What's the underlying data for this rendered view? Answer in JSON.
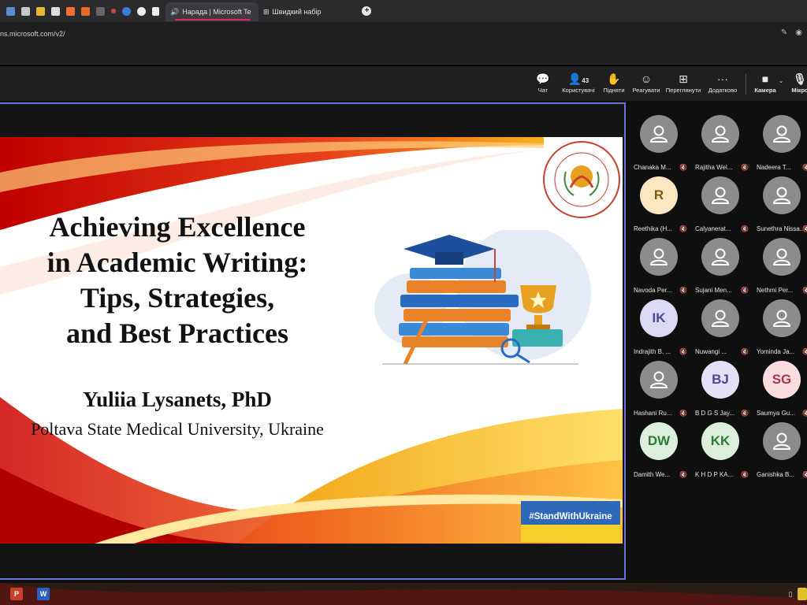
{
  "browser": {
    "tabs": [
      {
        "label": "Нарада | Microsoft Te",
        "active": true
      },
      {
        "label": "Швидкий набір",
        "active": false
      }
    ],
    "new_tab_label": "+",
    "url": "ns.microsoft.com/v2/"
  },
  "toolbar": {
    "chat": "Чат",
    "people": "Користувачі",
    "people_count": "43",
    "raise": "Підняти",
    "react": "Реагувати",
    "view": "Переглянути",
    "more": "Додатково",
    "camera": "Камера",
    "mic": "Мікро"
  },
  "slide": {
    "title_lines": [
      "Achieving Excellence",
      "in Academic Writing:",
      "Tips, Strategies,",
      "and Best Practices"
    ],
    "author": "Yuliia Lysanets, PhD",
    "affiliation": "Poltava State Medical University, Ukraine",
    "badge": "#StandWithUkraine"
  },
  "participants": [
    {
      "name": "Chanaka M...",
      "initials": ""
    },
    {
      "name": "Rajitha Wel...",
      "initials": ""
    },
    {
      "name": "Nadeera T...",
      "initials": ""
    },
    {
      "name": "Reethika (H...",
      "initials": "R",
      "color": "#fbe8c0",
      "text": "#7a5a10"
    },
    {
      "name": "Calyanerat...",
      "initials": ""
    },
    {
      "name": "Sunethra Nissa...",
      "initials": ""
    },
    {
      "name": "Navoda Per...",
      "initials": ""
    },
    {
      "name": "Sujani Men...",
      "initials": ""
    },
    {
      "name": "Nethmi Per...",
      "initials": ""
    },
    {
      "name": "Indrajith B. ...",
      "initials": "IK",
      "color": "#dcd9f5",
      "text": "#4b4693"
    },
    {
      "name": "Nuwangi ...",
      "initials": ""
    },
    {
      "name": "Yominda Ja...",
      "initials": ""
    },
    {
      "name": "Hashani Ru...",
      "initials": ""
    },
    {
      "name": "B D G S Jay...",
      "initials": "BJ",
      "color": "#e3e0f8",
      "text": "#4b4693"
    },
    {
      "name": "Saumya Gu...",
      "initials": "SG",
      "color": "#f9dde0",
      "text": "#a43747"
    },
    {
      "name": "Damith We...",
      "initials": "DW",
      "color": "#dcefdd",
      "text": "#2f7a34"
    },
    {
      "name": "K H D P KA...",
      "initials": "KK",
      "color": "#dcefdd",
      "text": "#2f7a34"
    },
    {
      "name": "Ganishka B...",
      "initials": ""
    }
  ],
  "colors": {
    "accent": "#6b6fd8",
    "live_tab": "#e0245e"
  }
}
